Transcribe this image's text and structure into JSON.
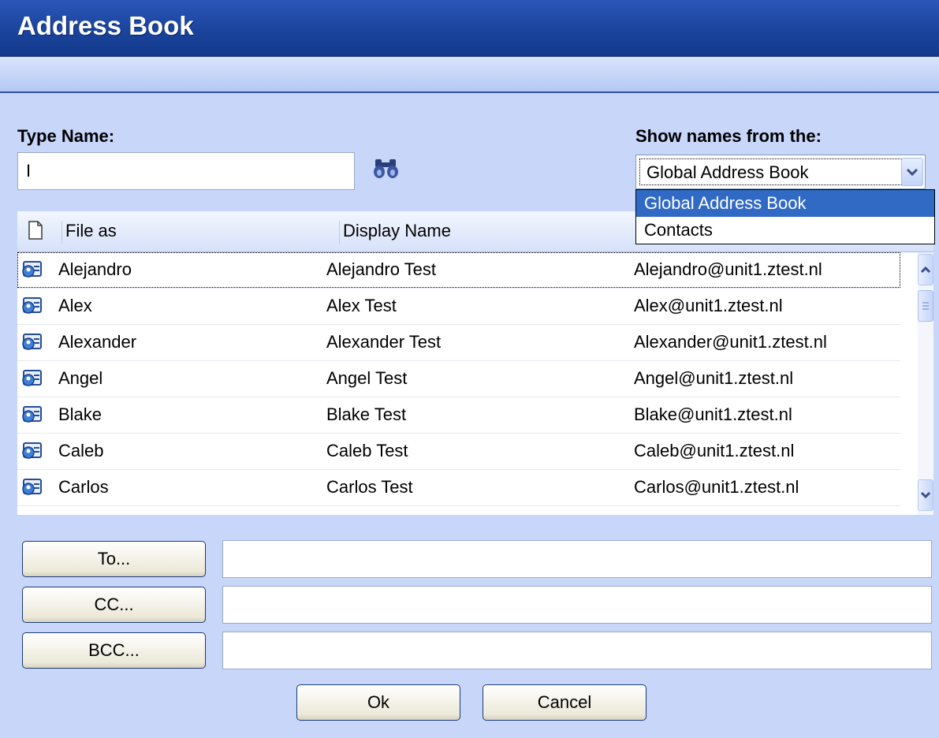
{
  "window": {
    "title": "Address Book"
  },
  "search": {
    "label": "Type Name:",
    "value": "I"
  },
  "source": {
    "label": "Show names from the:",
    "selected": "Global Address Book",
    "options": [
      "Global Address Book",
      "Contacts"
    ]
  },
  "grid": {
    "columns": [
      "File as",
      "Display Name"
    ],
    "rows": [
      {
        "file_as": "Alejandro",
        "display": "Alejandro Test",
        "email": "Alejandro@unit1.ztest.nl"
      },
      {
        "file_as": "Alex",
        "display": "Alex Test",
        "email": "Alex@unit1.ztest.nl"
      },
      {
        "file_as": "Alexander",
        "display": "Alexander Test",
        "email": "Alexander@unit1.ztest.nl"
      },
      {
        "file_as": "Angel",
        "display": "Angel Test",
        "email": "Angel@unit1.ztest.nl"
      },
      {
        "file_as": "Blake",
        "display": "Blake Test",
        "email": "Blake@unit1.ztest.nl"
      },
      {
        "file_as": "Caleb",
        "display": "Caleb Test",
        "email": "Caleb@unit1.ztest.nl"
      },
      {
        "file_as": "Carlos",
        "display": "Carlos Test",
        "email": "Carlos@unit1.ztest.nl"
      }
    ]
  },
  "recipients": {
    "to_label": "To...",
    "cc_label": "CC...",
    "bcc_label": "BCC..."
  },
  "actions": {
    "ok_label": "Ok",
    "cancel_label": "Cancel"
  },
  "icons": {
    "find": "binoculars-icon",
    "column_type": "document-icon",
    "contact": "contact-card-icon",
    "scroll_up": "chevron-up-icon",
    "scroll_down": "chevron-down-icon"
  },
  "colors": {
    "title_bar": "#19429a",
    "selection": "#316ac5",
    "background": "#c8d6fa"
  }
}
